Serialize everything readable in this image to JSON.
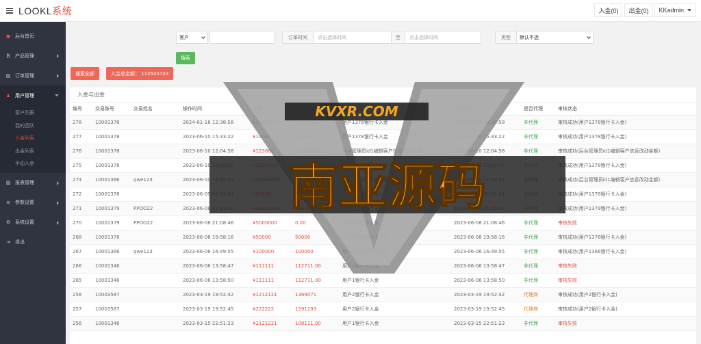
{
  "header": {
    "logo_main": "LOOKL",
    "logo_accent": "系统",
    "deposit_btn": "入金(0)",
    "withdraw_btn": "出金(0)",
    "user": "KKadmin"
  },
  "sidebar": {
    "items": [
      {
        "label": "后台首页",
        "icon": "home-icon"
      },
      {
        "label": "产品管理",
        "icon": "bitcoin-icon"
      },
      {
        "label": "订单管理",
        "icon": "clipboard-icon"
      },
      {
        "label": "用户管理",
        "icon": "user-icon"
      },
      {
        "label": "报表管理",
        "icon": "chart-icon"
      },
      {
        "label": "参数设置",
        "icon": "sliders-icon"
      },
      {
        "label": "系统设置",
        "icon": "gear-icon"
      },
      {
        "label": "退出",
        "icon": "logout-icon"
      }
    ],
    "sub_items": [
      "客户列表",
      "我的团队",
      "入金列表",
      "出金列表",
      "手动入金"
    ]
  },
  "filters": {
    "customer_select": "客户",
    "order_time_label": "订单时间",
    "time_from_placeholder": "点击选择时间",
    "to_label": "至",
    "time_to_placeholder": "点击选择时间",
    "type_label": "类型",
    "type_select": "默认不选",
    "search_btn": "搜索"
  },
  "actions": {
    "search_all": "搜索全部",
    "total_label": "入金总金额：",
    "total_value": "112545723"
  },
  "card": {
    "title": "入金与出金"
  },
  "table": {
    "columns": [
      "编号",
      "交易账号",
      "交易姓名",
      "操作时间",
      "金额",
      "到账金额",
      "备注",
      "审核时间",
      "是否代理",
      "审核状态"
    ],
    "rows": [
      [
        "278",
        "10001378",
        "",
        "2024-01-16 12:38:58",
        "¥1000000",
        "5275838",
        "用户1378银行卡入金",
        "2024-01-16 12:38:58",
        "非代理",
        "审核成功(用户1378银行卡入金)"
      ],
      [
        "277",
        "10001378",
        "",
        "2023-06-10 15:33:22",
        "¥1000000",
        "3268888",
        "用户1378银行卡入金",
        "2023-06-10 15:33:22",
        "非代理",
        "审核成功(用户1378银行卡入金)"
      ],
      [
        "276",
        "10001378",
        "",
        "2023-06-10 12:04:58",
        "¥123888",
        "1128888.00",
        "后台管理员id1编辑客户信息改动金额",
        "2023-06-10 12:04:58",
        "非代理",
        "审核成功(后台管理员id1编辑客户信息改动金额)"
      ],
      [
        "275",
        "10001378",
        "",
        "2023-06-10 12:00:26",
        "¥1000000",
        "1000000",
        "用户1378银行卡入金",
        "2023-06-10 12:00:26",
        "非代理",
        "审核成功(用户1378银行卡入金)"
      ],
      [
        "274",
        "10001366",
        "qwe123",
        "2023-06-10 11:55:33",
        "¥10489056",
        "10595000.00",
        "后台管理员id1编辑客户信息改动金额",
        "2023-06-10 11:55:33",
        "非代理",
        "审核成功(后台管理员id1编辑客户信息改动金额)"
      ],
      [
        "272",
        "10001378",
        "",
        "2023-06-09 21:01:04",
        "¥50000",
        "50000",
        "用户1378银行卡入金",
        "2023-06-09 21:01:04",
        "非代理",
        "审核成功(用户1378银行卡入金)"
      ],
      [
        "271",
        "10001379",
        "PPOO22",
        "2023-06-08 21:19:16",
        "¥88888888",
        "88888888",
        "用户1379银行卡入金",
        "2023-06-08 21:19:16",
        "非代理",
        "审核成功(用户1379银行卡入金)"
      ],
      [
        "270",
        "10001379",
        "PPOO22",
        "2023-06-08 21:08:46",
        "¥5000000",
        "0.00",
        "用户1银行卡入金",
        "2023-06-08 21:08:46",
        "非代理",
        "审核失败"
      ],
      [
        "268",
        "10001378",
        "",
        "2023-06-08 19:58:16",
        "¥50000",
        "50000",
        "用户1378银行卡入金",
        "2023-06-08 19:58:16",
        "非代理",
        "审核成功(用户1378银行卡入金)"
      ],
      [
        "267",
        "10001366",
        "qwe123",
        "2023-06-06 16:49:55",
        "¥100000",
        "100000",
        "用户1366银行卡入金",
        "2023-06-06 16:49:55",
        "非代理",
        "审核成功(用户1366银行卡入金)"
      ],
      [
        "266",
        "10001346",
        "",
        "2023-06-06 13:58:47",
        "¥111111",
        "112711.00",
        "用户1银行卡入金",
        "2023-06-06 13:58:47",
        "非代理",
        "审核失败"
      ],
      [
        "265",
        "10001346",
        "",
        "2023-06-06 13:58:50",
        "¥111111",
        "112711.00",
        "用户1银行卡入金",
        "2023-06-06 13:58:50",
        "非代理",
        "审核失败"
      ],
      [
        "258",
        "10003587",
        "",
        "2023-03-19 19:52:42",
        "¥1212121",
        "1369071",
        "用户2银行卡入金",
        "2023-03-19 19:52:42",
        "代理商",
        "审核成功(用户2银行卡入金)"
      ],
      [
        "257",
        "10003587",
        "",
        "2023-03-19 19:52:45",
        "¥222222",
        "1591293",
        "用户2银行卡入金",
        "2023-03-19 19:52:45",
        "代理商",
        "审核成功(用户2银行卡入金)"
      ],
      [
        "256",
        "10001346",
        "",
        "2023-03-15 22:51:23",
        "¥2121221",
        "108111.00",
        "用户1银行卡入金",
        "2023-03-15 22:51:23",
        "非代理",
        "审核失败"
      ]
    ]
  },
  "watermark": {
    "url": "KVXR.COM",
    "text": "南亚源码"
  }
}
